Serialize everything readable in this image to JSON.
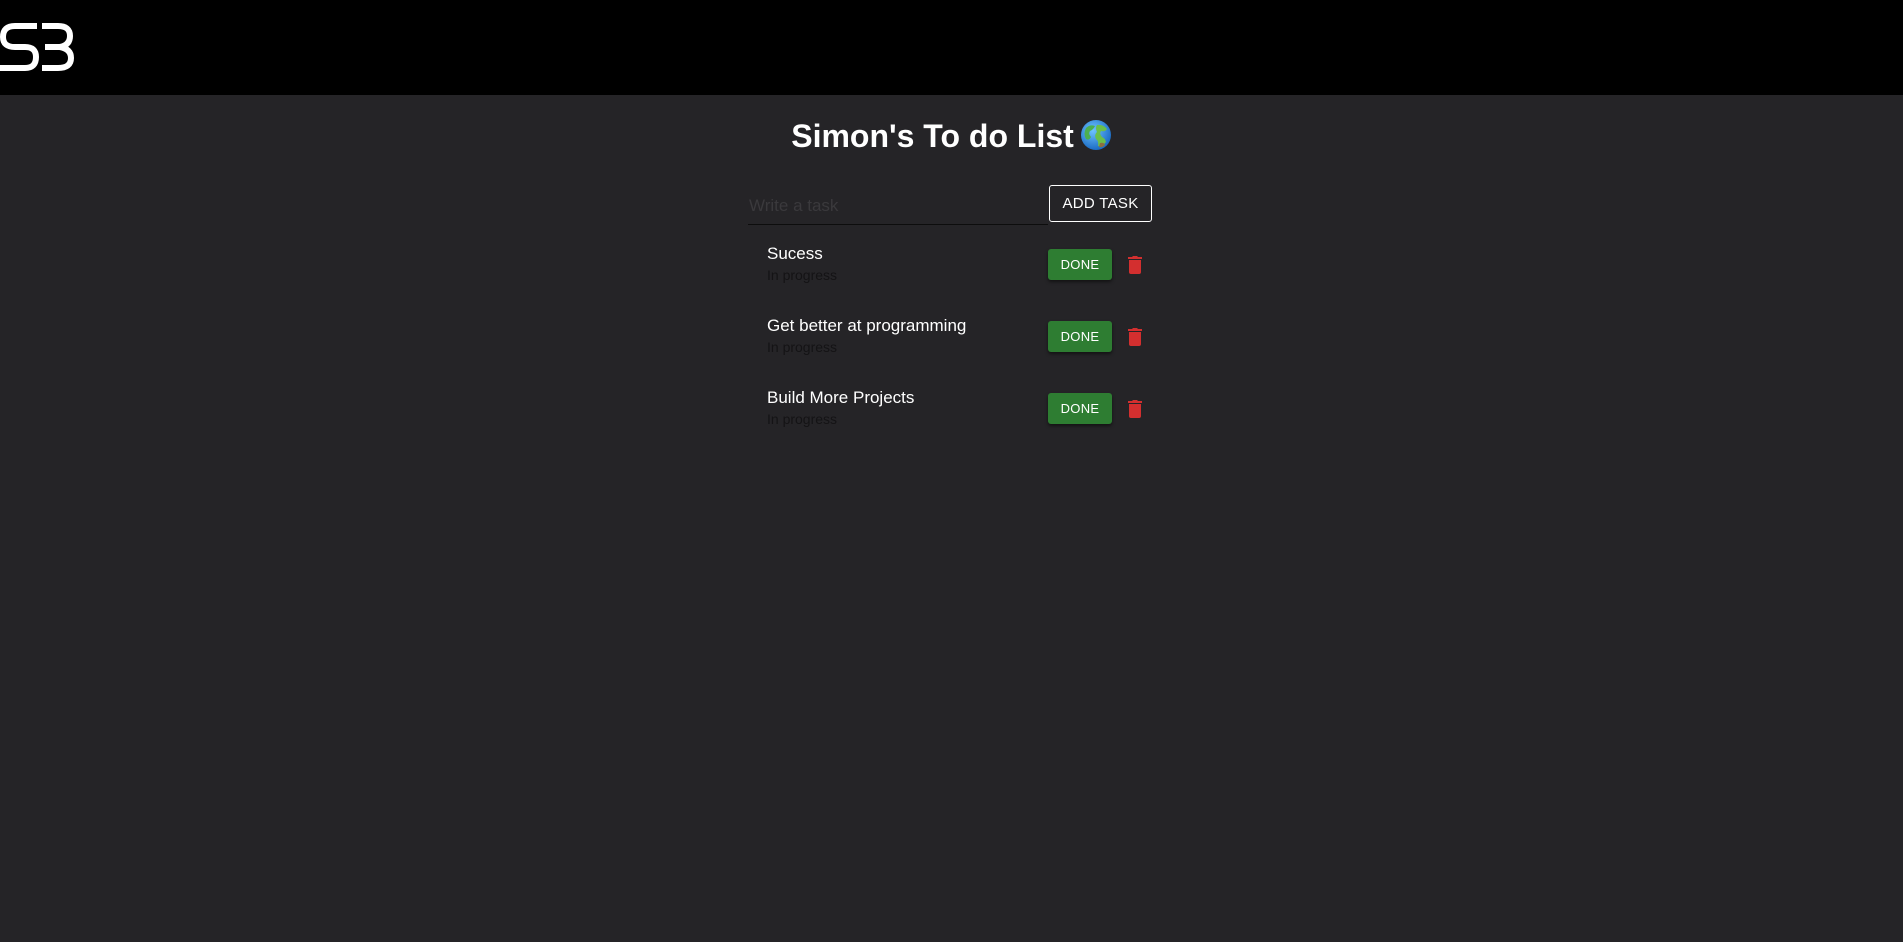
{
  "header": {
    "logo_icon": "sb-logo-icon"
  },
  "page": {
    "title": "Simon's To do List",
    "title_icon": "globe-icon"
  },
  "new_task": {
    "placeholder": "Write a task",
    "value": "",
    "add_label": "ADD TASK"
  },
  "tasks": [
    {
      "title": "Sucess",
      "status": "In progress",
      "done_label": "DONE",
      "delete_icon": "trash-icon"
    },
    {
      "title": "Get better at programming",
      "status": "In progress",
      "done_label": "DONE",
      "delete_icon": "trash-icon"
    },
    {
      "title": "Build More Projects",
      "status": "In progress",
      "done_label": "DONE",
      "delete_icon": "trash-icon"
    }
  ],
  "colors": {
    "header_bg": "#000000",
    "page_bg": "#252427",
    "done_button": "#2e7d32",
    "delete_icon": "#d32f2f",
    "text": "#ffffff"
  }
}
